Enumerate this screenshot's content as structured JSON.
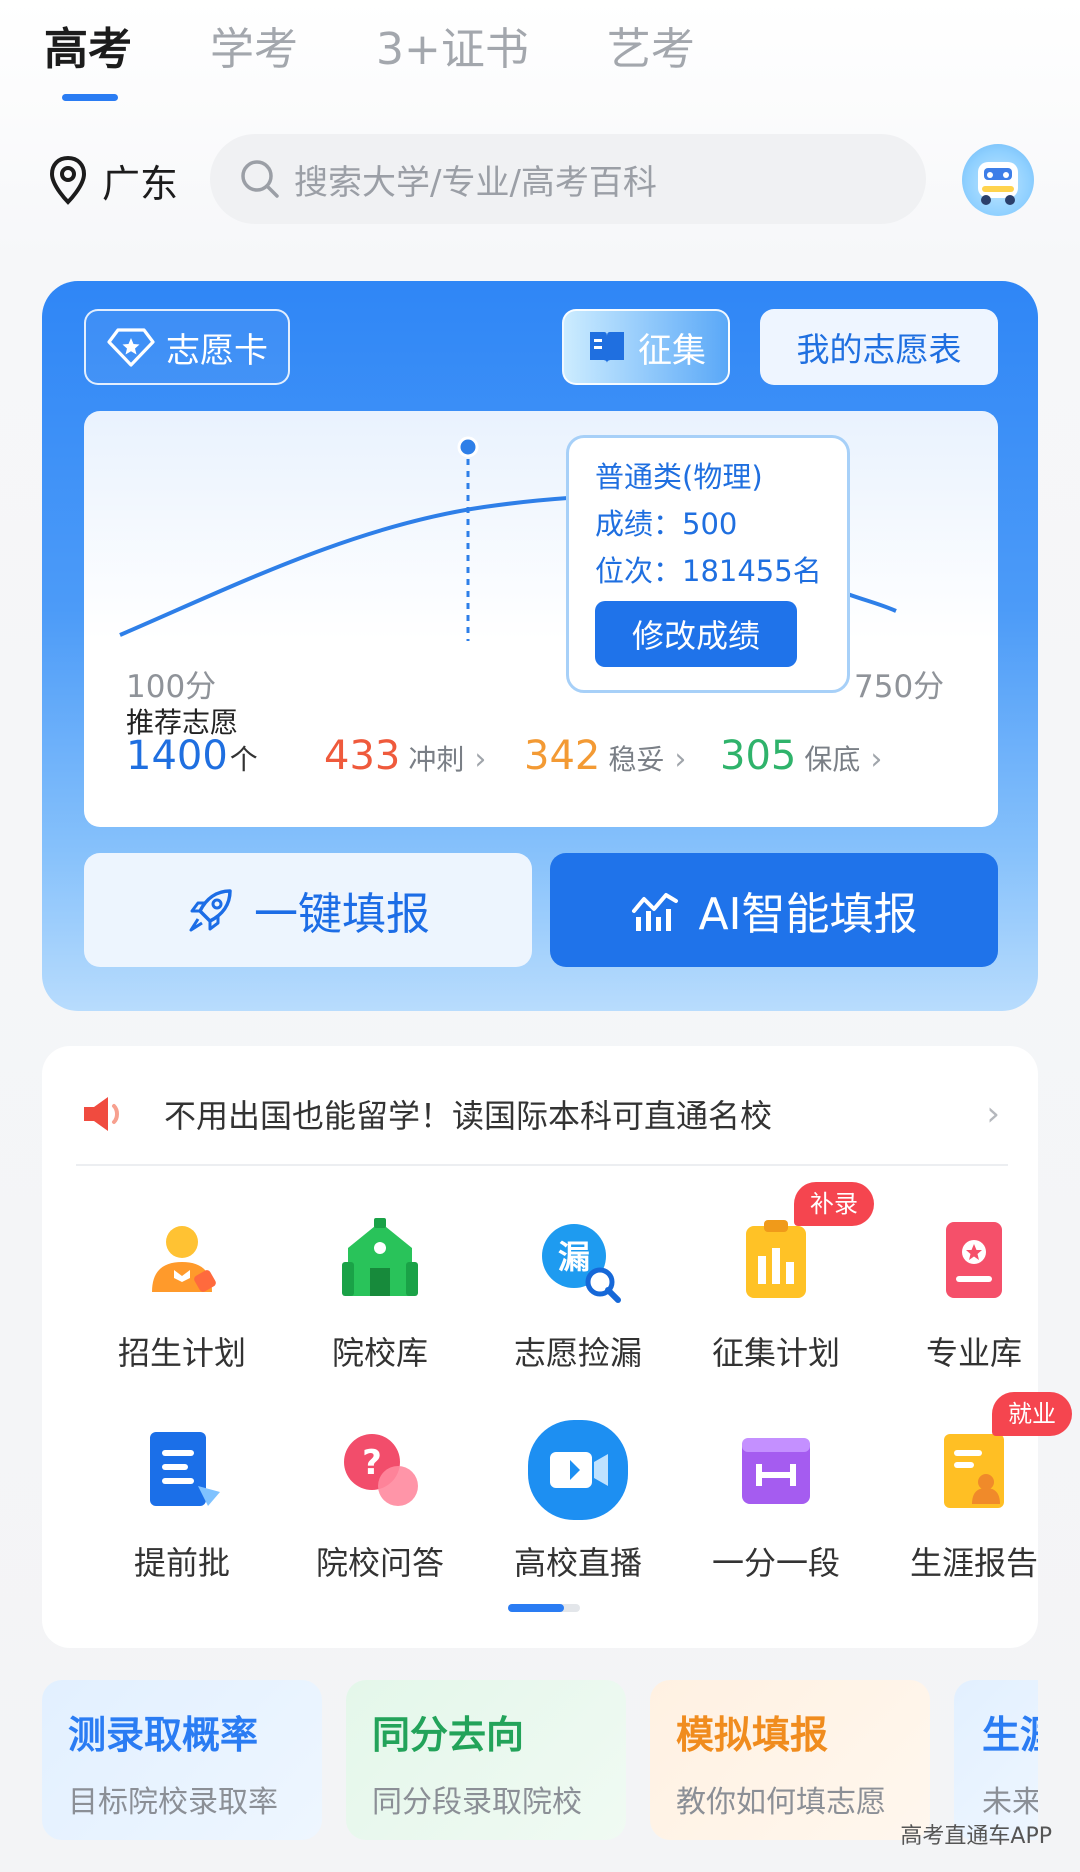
{
  "top_tabs": [
    {
      "label": "高考",
      "active": true
    },
    {
      "label": "学考",
      "active": false
    },
    {
      "label": "3+证书",
      "active": false
    },
    {
      "label": "艺考",
      "active": false
    }
  ],
  "location": {
    "label": "广东",
    "icon": "location-pin-icon"
  },
  "search": {
    "placeholder": "搜索大学/专业/高考百科",
    "icon": "search-icon"
  },
  "hero": {
    "chips": {
      "card": "志愿卡",
      "collect": "征集",
      "my_table": "我的志愿表"
    },
    "tooltip": {
      "category": "普通类(物理)",
      "score_line": "成绩：500",
      "rank_line": "位次：181455名",
      "edit_button": "修改成绩"
    },
    "axis": {
      "min_label": "100分",
      "max_label": "750分"
    },
    "recommend": {
      "title": "推荐志愿",
      "count": "1400",
      "unit": "个",
      "stats": [
        {
          "value": "433",
          "label": "冲刺",
          "color": "#ef5a3c"
        },
        {
          "value": "342",
          "label": "稳妥",
          "color": "#f39a34"
        },
        {
          "value": "305",
          "label": "保底",
          "color": "#2fb36b"
        }
      ]
    },
    "buttons": {
      "quick": "一键填报",
      "ai": "AI智能填报"
    },
    "colors": {
      "primary": "#1f73ea",
      "card_gradient_top": "#2f86f6",
      "card_gradient_bottom": "#b8dcfd"
    }
  },
  "notice": {
    "text": "不用出国也能留学！读国际本科可直通名校",
    "icon": "speaker-icon"
  },
  "tools": [
    {
      "label": "招生计划",
      "icon": "enrollment-plan-icon"
    },
    {
      "label": "院校库",
      "icon": "school-library-icon"
    },
    {
      "label": "志愿捡漏",
      "icon": "leak-search-icon"
    },
    {
      "label": "征集计划",
      "icon": "collect-plan-icon",
      "badge": "补录"
    },
    {
      "label": "专业库",
      "icon": "major-library-icon"
    },
    {
      "label": "提前批",
      "icon": "early-batch-icon"
    },
    {
      "label": "院校问答",
      "icon": "qa-icon"
    },
    {
      "label": "高校直播",
      "icon": "live-video-icon"
    },
    {
      "label": "一分一段",
      "icon": "score-segment-icon"
    },
    {
      "label": "生涯报告",
      "icon": "career-report-icon",
      "badge": "就业"
    }
  ],
  "features": [
    {
      "title": "测录取概率",
      "subtitle": "目标院校录取率",
      "color": "#2a7cf3"
    },
    {
      "title": "同分去向",
      "subtitle": "同分段录取院校",
      "color": "#23a35a"
    },
    {
      "title": "模拟填报",
      "subtitle": "教你如何填志愿",
      "color": "#f08c1e"
    },
    {
      "title": "生涯",
      "subtitle": "未来",
      "color": "#2a7cf3"
    }
  ],
  "watermark": "高考直通车APP"
}
